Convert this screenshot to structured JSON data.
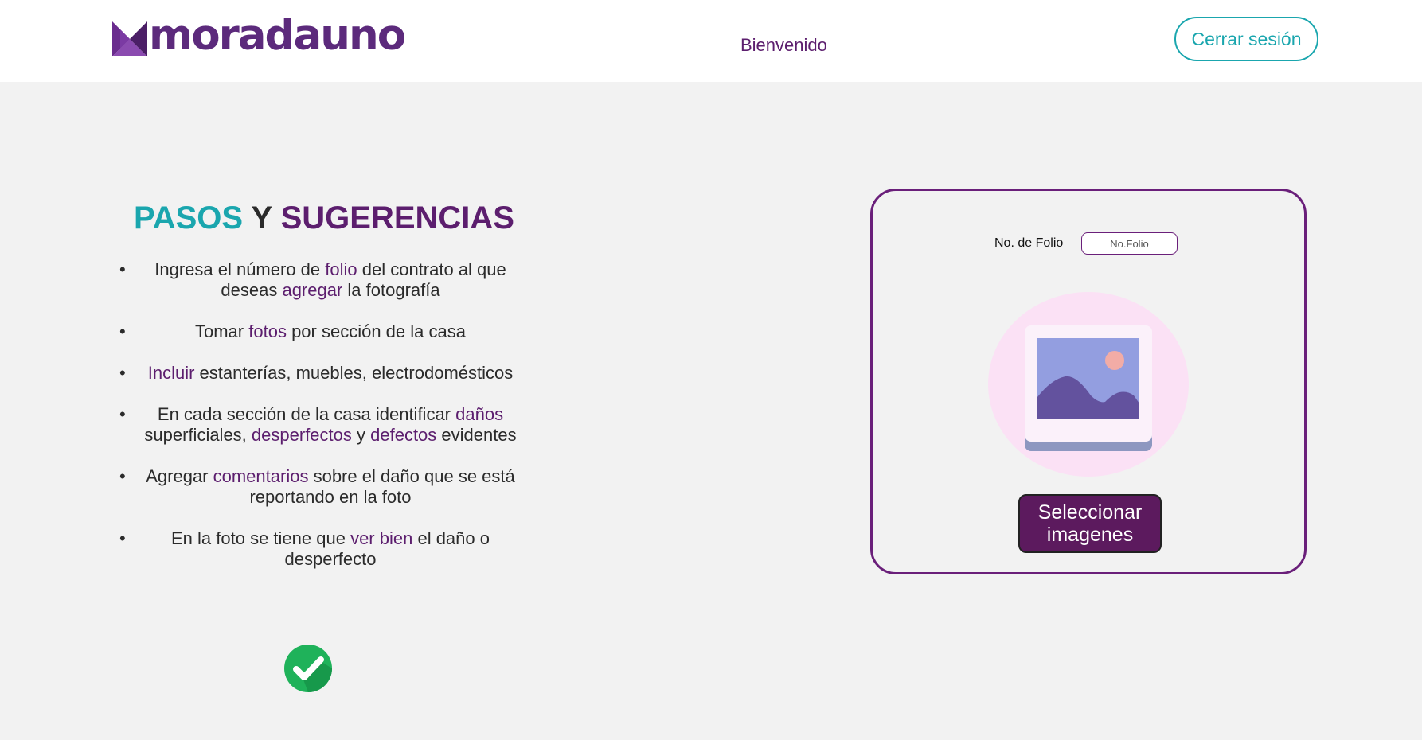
{
  "header": {
    "logo_text": "moradauno",
    "welcome": "Bienvenido",
    "logout_label": "Cerrar sesión"
  },
  "steps": {
    "title_part1": "PASOS",
    "title_part2": "Y",
    "title_part3": "SUGERENCIAS",
    "bullet": "•",
    "items": [
      {
        "a": "Ingresa el número de ",
        "b": "folio",
        "c": " del contrato al que deseas ",
        "d": "agregar",
        "e": " la fotografía"
      },
      {
        "a": "Tomar ",
        "b": "fotos",
        "c": " por sección de la casa"
      },
      {
        "a": "",
        "b": "Incluir",
        "c": " estanterías, muebles, electrodomésticos"
      },
      {
        "a": "En cada sección de la casa identificar ",
        "b": "daños",
        "c": " superficiales, ",
        "d": "desperfectos",
        "e": " y ",
        "f": "defectos",
        "g": " evidentes"
      },
      {
        "a": "Agregar ",
        "b": "comentarios",
        "c": " sobre el daño que se está reportando en la foto"
      },
      {
        "a": "En la foto se tiene que ",
        "b": "ver bien",
        "c": " el daño o desperfecto"
      }
    ]
  },
  "upload": {
    "folio_label": "No. de Folio",
    "folio_placeholder": "No.Folio",
    "folio_value": "",
    "select_label": "Seleccionar imagenes"
  },
  "colors": {
    "brand_purple": "#5c1e6e",
    "accent_teal": "#1aa6ae",
    "success_green": "#1fb25a"
  },
  "icons": {
    "check": "check-circle-icon",
    "image": "image-placeholder-icon"
  }
}
